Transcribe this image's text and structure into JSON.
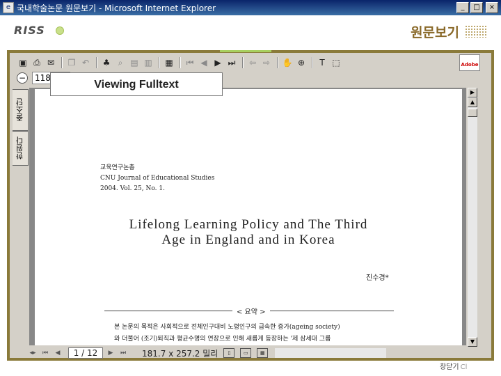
{
  "window": {
    "title": "국내학술논문 원문보기 - Microsoft Internet Explorer",
    "minimize": "_",
    "maximize": "□",
    "close": "×"
  },
  "header": {
    "logo": "RISS",
    "title": "원문보기"
  },
  "viewer": {
    "zoom_value": "118",
    "tooltip": "Viewing Fulltext",
    "side_tabs": [
      "출소단",
      "한원다"
    ],
    "adobe_label": "Adobe"
  },
  "document": {
    "journal_lines": [
      "교육연구논총",
      "CNU Journal of Educational Studies",
      "2004. Vol. 25, No. 1."
    ],
    "title_lines": [
      "Lifelong Learning Policy and The Third",
      "Age in England and in Korea"
    ],
    "author": "진수경*",
    "abstract_label": "< 요약 >",
    "abstract_lines": [
      "본 논문의 목적은 사회적으로 전체인구대비 노령인구의 급속한 증가(ageing society)",
      "와 더불어 (조기)퇴직과 평균수명의 연장으로 인해 새롭게 등장하는 '제 삼세대 그룹"
    ]
  },
  "statusbar": {
    "page": "1 / 12",
    "dimensions": "181.7 x 257.2 밀리"
  },
  "footer": {
    "close_label": "창닫기",
    "close_en": "Cl"
  },
  "colors": {
    "titlebar": "#0a246a",
    "frame": "#8a7a3a",
    "accent": "#a8d060",
    "header_title": "#8a6a2a"
  }
}
